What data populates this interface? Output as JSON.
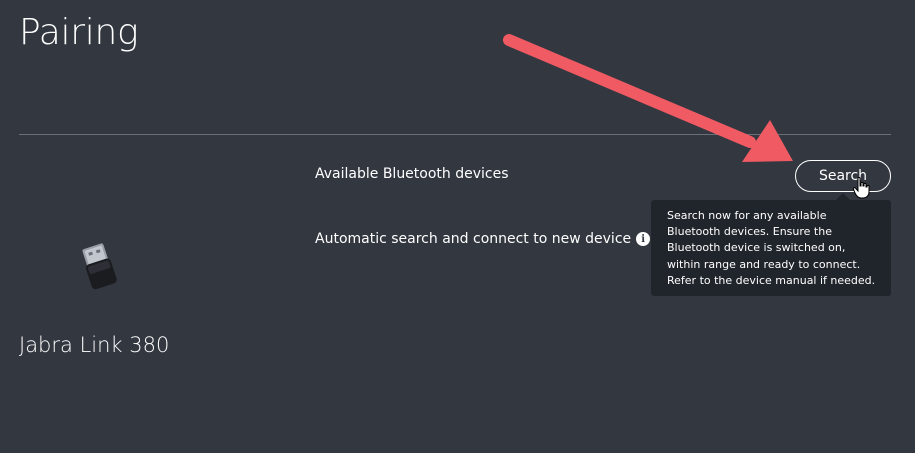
{
  "page": {
    "title": "Pairing"
  },
  "device": {
    "name": "Jabra Link 380",
    "image_icon": "usb-dongle-icon"
  },
  "settings": {
    "available_label": "Available Bluetooth devices",
    "auto_label": "Automatic search and connect to new device",
    "info_icon": "i",
    "search_button_label": "Search"
  },
  "tooltip": {
    "text": "Search now for any available Bluetooth devices. Ensure the Bluetooth device is switched on, within range and ready to connect. Refer to the device manual if needed."
  },
  "colors": {
    "background": "#323740",
    "tooltip_background": "#20242b",
    "annotation_arrow": "#ef5a63",
    "divider": "#6a6f78"
  },
  "icons": {
    "cursor": "hand-pointer-icon",
    "annotation": "red-arrow-annotation"
  }
}
